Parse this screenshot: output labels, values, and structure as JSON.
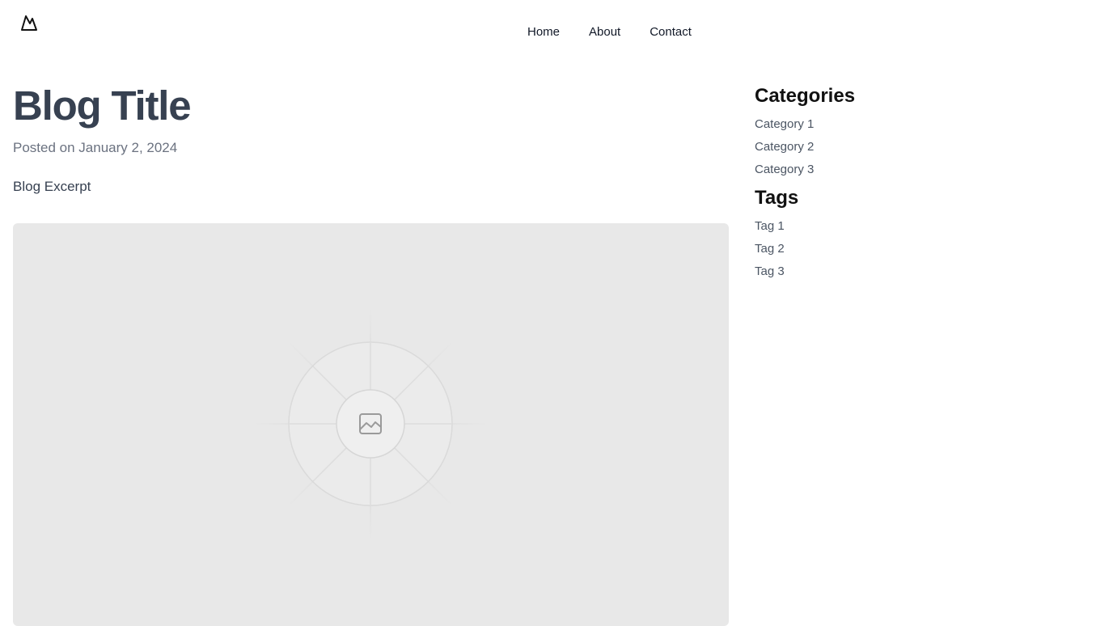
{
  "header": {
    "logo_icon": "mountain-logo-icon",
    "nav": [
      "Home",
      "About",
      "Contact"
    ]
  },
  "post": {
    "title": "Blog Title",
    "posted": "Posted on January 2, 2024",
    "excerpt": "Blog Excerpt",
    "image_icon": "image-placeholder-icon"
  },
  "sidebar": {
    "categories_heading": "Categories",
    "categories": [
      "Category 1",
      "Category 2",
      "Category 3"
    ],
    "tags_heading": "Tags",
    "tags": [
      "Tag 1",
      "Tag 2",
      "Tag 3"
    ]
  },
  "colors": {
    "text_dark": "#374151",
    "text_muted": "#6b7280",
    "placeholder_bg": "#e8e8e8"
  }
}
